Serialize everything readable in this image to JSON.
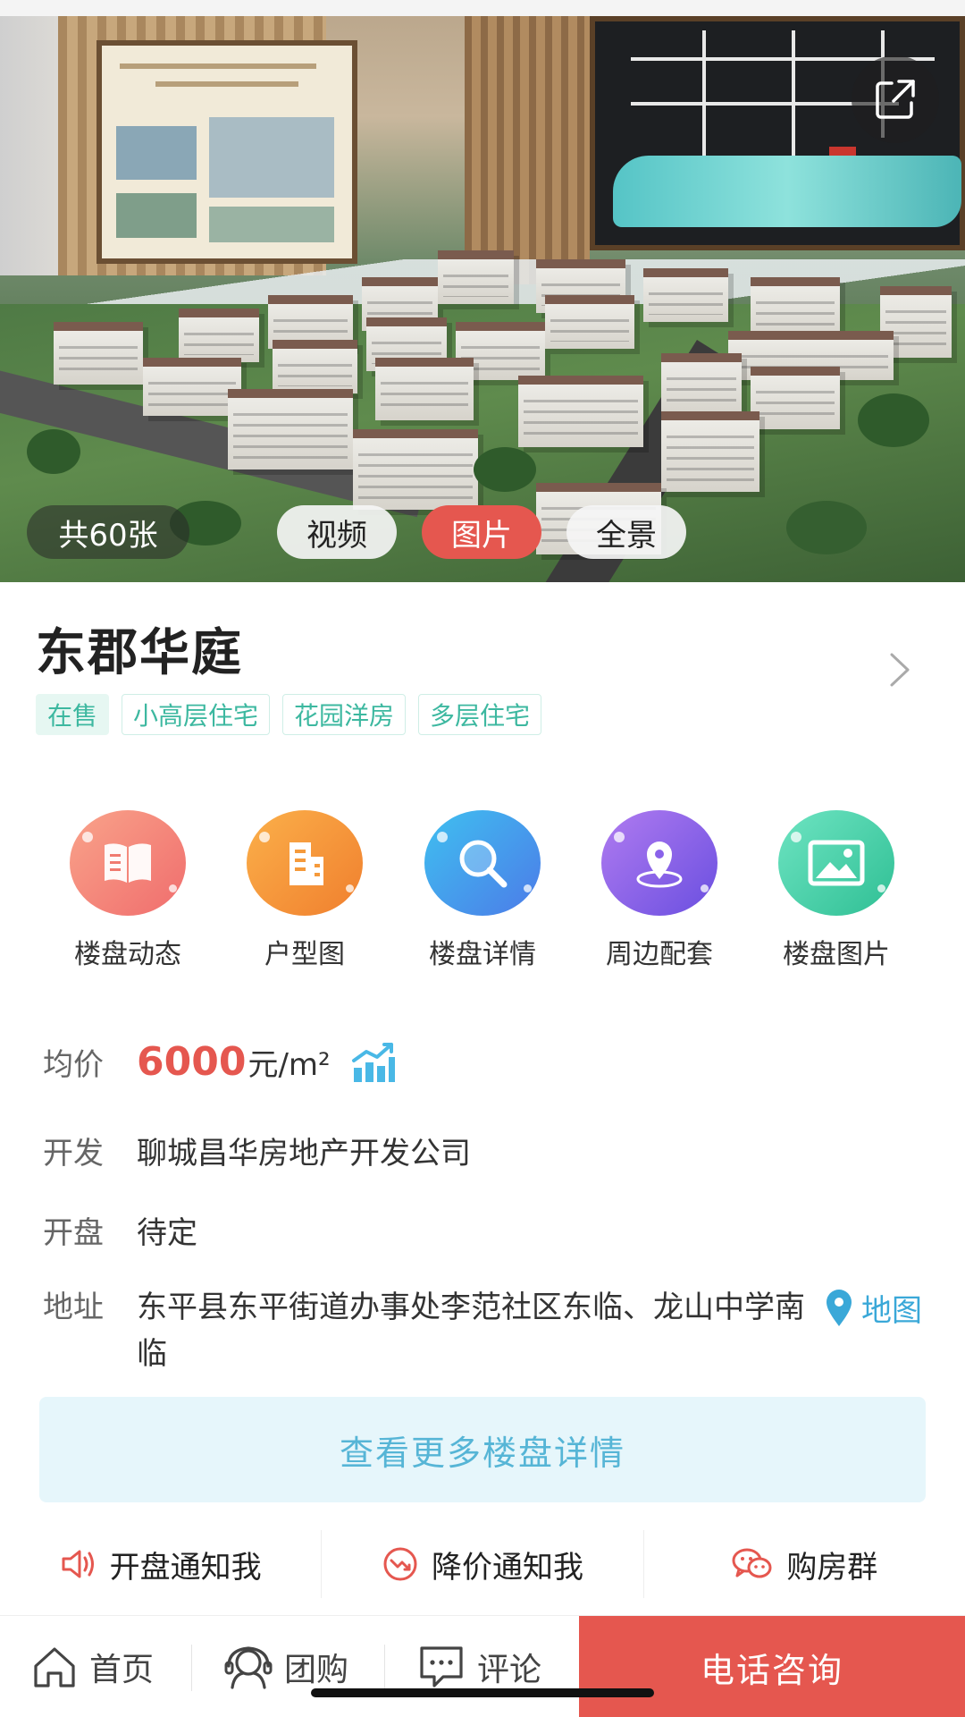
{
  "gallery": {
    "count_label": "共60张",
    "tabs": [
      {
        "label": "视频",
        "active": false
      },
      {
        "label": "图片",
        "active": true
      },
      {
        "label": "全景",
        "active": false
      }
    ]
  },
  "property": {
    "name": "东郡华庭",
    "tags": [
      "在售",
      "小高层住宅",
      "花园洋房",
      "多层住宅"
    ]
  },
  "quick_nav": [
    {
      "label": "楼盘动态",
      "icon": "book-icon"
    },
    {
      "label": "户型图",
      "icon": "building-icon"
    },
    {
      "label": "楼盘详情",
      "icon": "search-icon"
    },
    {
      "label": "周边配套",
      "icon": "location-pin-icon"
    },
    {
      "label": "楼盘图片",
      "icon": "image-icon"
    }
  ],
  "info": {
    "price_label": "均价",
    "price_value": "6000",
    "price_unit": "元/m²",
    "developer_label": "开发",
    "developer_value": "聊城昌华房地产开发公司",
    "opening_label": "开盘",
    "opening_value": "待定",
    "address_label": "地址",
    "address_value": "东平县东平街道办事处李范社区东临、龙山中学南临",
    "map_link": "地图"
  },
  "more_details_button": "查看更多楼盘详情",
  "notify": [
    {
      "label": "开盘通知我",
      "icon": "speaker-icon"
    },
    {
      "label": "降价通知我",
      "icon": "price-drop-icon"
    },
    {
      "label": "购房群",
      "icon": "wechat-icon"
    }
  ],
  "bottom_nav": {
    "home": "首页",
    "group_buy": "团购",
    "comments": "评论",
    "call": "电话咨询"
  },
  "colors": {
    "accent_red": "#e5574f",
    "tag_green": "#3db8a0",
    "link_blue": "#3aa8d8"
  }
}
